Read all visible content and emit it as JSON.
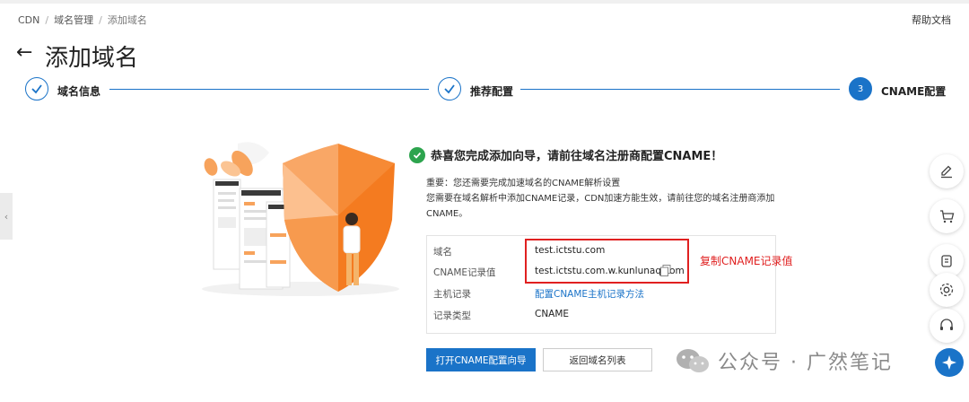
{
  "breadcrumb": [
    "CDN",
    "域名管理",
    "添加域名"
  ],
  "help_link": "帮助文档",
  "page_title": "添加域名",
  "steps": [
    {
      "label": "域名信息",
      "state": "done"
    },
    {
      "label": "推荐配置",
      "state": "done"
    },
    {
      "label": "CNAME配置",
      "state": "active",
      "number": "3"
    }
  ],
  "success": {
    "message": "恭喜您完成添加向导，请前往域名注册商配置CNAME！",
    "note_line1": "重要：您还需要完成加速域名的CNAME解析设置",
    "note_line2": "您需要在域名解析中添加CNAME记录，CDN加速方能生效，请前往您的域名注册商添加",
    "note_line3": "CNAME。"
  },
  "records": [
    {
      "key": "域名",
      "value": "test.ictstu.com"
    },
    {
      "key": "CNAME记录值",
      "value": "test.ictstu.com.w.kunlunaq.com",
      "copyable": true
    },
    {
      "key": "主机记录",
      "value": "配置CNAME主机记录方法",
      "link": true
    },
    {
      "key": "记录类型",
      "value": "CNAME"
    }
  ],
  "annotation": "复制CNAME记录值",
  "buttons": {
    "primary": "打开CNAME配置向导",
    "secondary": "返回域名列表"
  },
  "watermark": "公众号 · 广然笔记",
  "colors": {
    "accent": "#1a73c8",
    "success": "#2da44e",
    "annotation": "#e02020",
    "shield_orange": "#f47b20"
  },
  "right_rail_icons": [
    "edit-icon",
    "cart-icon",
    "tool-icon",
    "gear-icon",
    "headset-icon"
  ]
}
